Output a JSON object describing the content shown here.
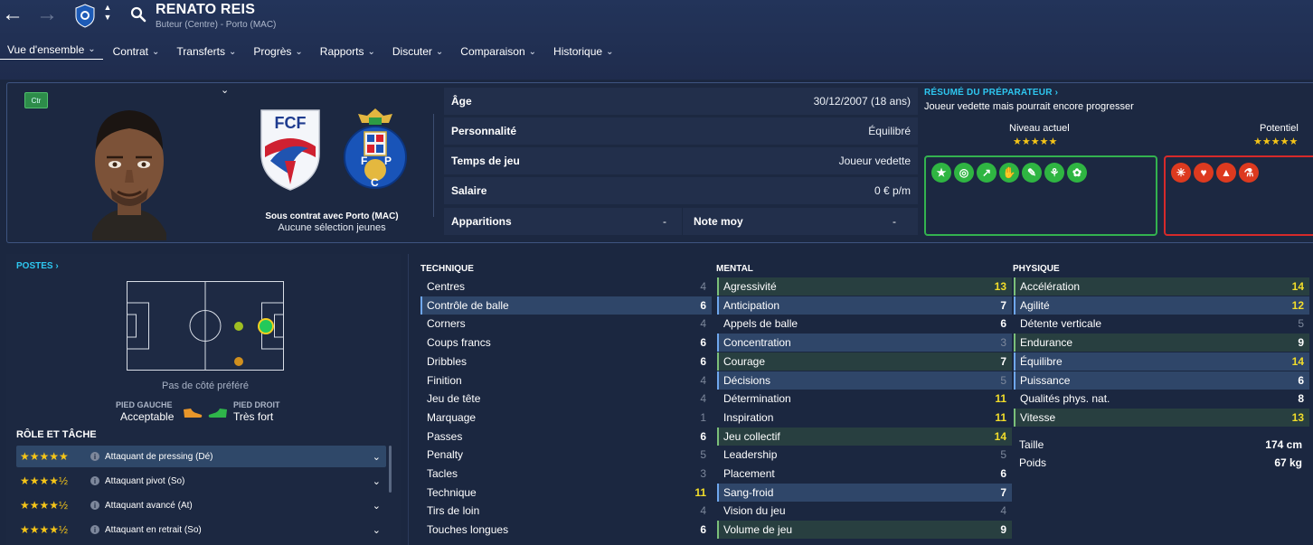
{
  "header": {
    "player_name": "RENATO REIS",
    "player_subtitle": "Buteur (Centre) - Porto (MAC)"
  },
  "tabs": [
    {
      "label": "Vue d'ensemble",
      "active": true
    },
    {
      "label": "Contrat"
    },
    {
      "label": "Transferts"
    },
    {
      "label": "Progrès"
    },
    {
      "label": "Rapports"
    },
    {
      "label": "Discuter"
    },
    {
      "label": "Comparaison"
    },
    {
      "label": "Historique"
    }
  ],
  "profile": {
    "position_badge": "Ctr",
    "contract_status": "Sous contrat avec Porto (MAC)",
    "youth_caps": "Aucune sélection jeunes",
    "national_crest_text": "FCF",
    "club_crest_text": "FCP"
  },
  "info": {
    "age_label": "Âge",
    "age_value": "30/12/2007 (18 ans)",
    "personality_label": "Personnalité",
    "personality_value": "Équilibré",
    "playing_time_label": "Temps de jeu",
    "playing_time_value": "Joueur vedette",
    "salary_label": "Salaire",
    "salary_value": "0 € p/m",
    "apps_label": "Apparitions",
    "apps_value": "-",
    "avg_rating_label": "Note moy",
    "avg_rating_value": "-"
  },
  "coach": {
    "title": "RÉSUMÉ DU PRÉPARATEUR ›",
    "summary": "Joueur vedette mais pourrait encore progresser",
    "current_label": "Niveau actuel",
    "current_stars": "★★★★★",
    "current_rating": 5,
    "potential_label": "Potentiel",
    "potential_stars": "★★★★★",
    "potential_rating": 5,
    "strength_icons": [
      "star-icon",
      "target-icon",
      "trend-up-icon",
      "hand-icon",
      "pen-icon",
      "ball-icon",
      "feather-icon"
    ],
    "weakness_icons": [
      "injury-icon",
      "heart-icon",
      "mountain-icon",
      "flask-icon"
    ]
  },
  "positions": {
    "title": "POSTES ›",
    "no_side": "Pas de côté préféré",
    "left_foot_label": "PIED GAUCHE",
    "left_foot_value": "Acceptable",
    "right_foot_label": "PIED DROIT",
    "right_foot_value": "Très fort"
  },
  "roles": {
    "title": "RÔLE ET TÂCHE",
    "items": [
      {
        "stars": "★★★★★",
        "rating": 5,
        "name": "Attaquant de pressing (Dé)"
      },
      {
        "stars": "★★★★½",
        "rating": 4.5,
        "name": "Attaquant pivot (So)"
      },
      {
        "stars": "★★★★½",
        "rating": 4.5,
        "name": "Attaquant avancé (At)"
      },
      {
        "stars": "★★★★½",
        "rating": 4.5,
        "name": "Attaquant en retrait (So)"
      }
    ]
  },
  "attributes": {
    "technique_title": "TECHNIQUE",
    "mental_title": "MENTAL",
    "physique_title": "PHYSIQUE",
    "technique": [
      {
        "name": "Centres",
        "value": "4"
      },
      {
        "name": "Contrôle de balle",
        "value": "6"
      },
      {
        "name": "Corners",
        "value": "4"
      },
      {
        "name": "Coups francs",
        "value": "6"
      },
      {
        "name": "Dribbles",
        "value": "6"
      },
      {
        "name": "Finition",
        "value": "4"
      },
      {
        "name": "Jeu de tête",
        "value": "4"
      },
      {
        "name": "Marquage",
        "value": "1"
      },
      {
        "name": "Passes",
        "value": "6"
      },
      {
        "name": "Penalty",
        "value": "5"
      },
      {
        "name": "Tacles",
        "value": "3"
      },
      {
        "name": "Technique",
        "value": "11"
      },
      {
        "name": "Tirs de loin",
        "value": "4"
      },
      {
        "name": "Touches longues",
        "value": "6"
      }
    ],
    "mental": [
      {
        "name": "Agressivité",
        "value": "13"
      },
      {
        "name": "Anticipation",
        "value": "7"
      },
      {
        "name": "Appels de balle",
        "value": "6"
      },
      {
        "name": "Concentration",
        "value": "3"
      },
      {
        "name": "Courage",
        "value": "7"
      },
      {
        "name": "Décisions",
        "value": "5"
      },
      {
        "name": "Détermination",
        "value": "11"
      },
      {
        "name": "Inspiration",
        "value": "11"
      },
      {
        "name": "Jeu collectif",
        "value": "14"
      },
      {
        "name": "Leadership",
        "value": "5"
      },
      {
        "name": "Placement",
        "value": "6"
      },
      {
        "name": "Sang-froid",
        "value": "7"
      },
      {
        "name": "Vision du jeu",
        "value": "4"
      },
      {
        "name": "Volume de jeu",
        "value": "9"
      }
    ],
    "physique": [
      {
        "name": "Accélération",
        "value": "14"
      },
      {
        "name": "Agilité",
        "value": "12"
      },
      {
        "name": "Détente verticale",
        "value": "5"
      },
      {
        "name": "Endurance",
        "value": "9"
      },
      {
        "name": "Équilibre",
        "value": "14"
      },
      {
        "name": "Puissance",
        "value": "6"
      },
      {
        "name": "Qualités phys. nat.",
        "value": "8"
      },
      {
        "name": "Vitesse",
        "value": "13"
      }
    ],
    "height_label": "Taille",
    "height_value": "174 cm",
    "weight_label": "Poids",
    "weight_value": "67 kg"
  },
  "colors": {
    "accent_cyan": "#2ec7f0",
    "star_yellow": "#f5c518",
    "strength_green": "#33b24f",
    "weakness_red": "#d62a2a",
    "highlight_value": "#f2dd2a"
  }
}
